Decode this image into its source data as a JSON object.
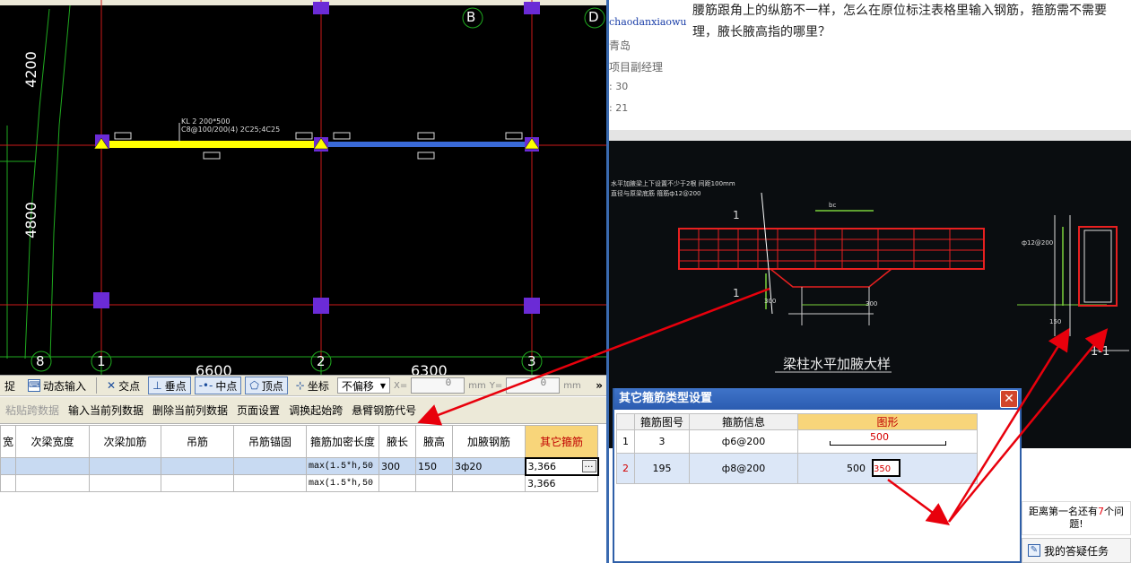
{
  "cad": {
    "axis_labels": {
      "b": "B",
      "d": "D",
      "n8": "8",
      "n1": "1",
      "n2": "2",
      "n3": "3"
    },
    "dims": {
      "d4200": "4200",
      "d4800": "4800",
      "d6600": "6600",
      "d6300": "6300"
    },
    "beam_label_line1": "KL 2 200*500",
    "beam_label_line2": "C8@100/200(4) 2C25;4C25"
  },
  "toolbar": {
    "capture": "捉",
    "dynamic_input": "动态输入",
    "intersection": "交点",
    "perpendicular": "垂点",
    "midpoint": "中点",
    "vertex": "顶点",
    "coordinate": "坐标",
    "offset_select": "不偏移",
    "x_label": "X=",
    "x_value": "0",
    "x_unit": "mm",
    "y_label": "Y=",
    "y_value": "0",
    "y_unit": "mm",
    "more": "»"
  },
  "menu": {
    "paste": "粘贴跨数据",
    "input_col": "输入当前列数据",
    "delete_col": "删除当前列数据",
    "page_setup": "页面设置",
    "swap_start": "调换起始跨",
    "cantilever": "悬臂钢筋代号"
  },
  "grid": {
    "headers": [
      "宽",
      "次梁宽度",
      "次梁加筋",
      "吊筋",
      "吊筋锚固",
      "箍筋加密长度",
      "腋长",
      "腋高",
      "加腋钢筋",
      "其它箍筋"
    ],
    "rows": [
      [
        "",
        "",
        "",
        "",
        "",
        "max(1.5*h,50",
        "300",
        "150",
        "3ф20",
        "3,366"
      ],
      [
        "",
        "",
        "",
        "",
        "",
        "max(1.5*h,50",
        "",
        "",
        "",
        "3,366"
      ]
    ],
    "ellipsis": "…"
  },
  "question": {
    "text": "腰筋跟角上的纵筋不一样，怎么在原位标注表格里输入钢筋，箍筋需不需要理，腋长腋高指的哪里？"
  },
  "profile": {
    "username": "chaodanxiaowu",
    "city": "青岛",
    "title": "项目副经理",
    "stat1": ": 30",
    "stat2": ": 21"
  },
  "photo": {
    "title": "梁柱水平加腋大样",
    "note_line1": "水平加腋梁上下设置不少于2根 间距100mm",
    "note_line2": "直径与原梁底筋 箍筋ф12@200",
    "section_label": "1-1",
    "dim300a": "300",
    "dim300b": "300",
    "dim150": "150",
    "bc": "bc",
    "rebar": "ф12@200",
    "label1": "1",
    "label2": "1"
  },
  "dialog": {
    "title": "其它箍筋类型设置",
    "close": "✕",
    "headers": [
      "",
      "箍筋图号",
      "箍筋信息",
      "图形"
    ],
    "rows": [
      {
        "idx": "1",
        "code": "3",
        "info": "ф6@200",
        "shape_value": "500"
      },
      {
        "idx": "2",
        "code": "195",
        "info": "ф8@200",
        "shape_left": "500",
        "shape_value": "350"
      }
    ]
  },
  "sidebar": {
    "rank_text_a": "距离第一名还有",
    "rank_num": "7",
    "rank_text_b": "个问",
    "rank_text_c": "题!",
    "task": "我的答疑任务"
  },
  "colors": {
    "accent_red": "#e8000c",
    "dialog_blue": "#2b5cb0",
    "header_hl": "#f8d57a"
  }
}
